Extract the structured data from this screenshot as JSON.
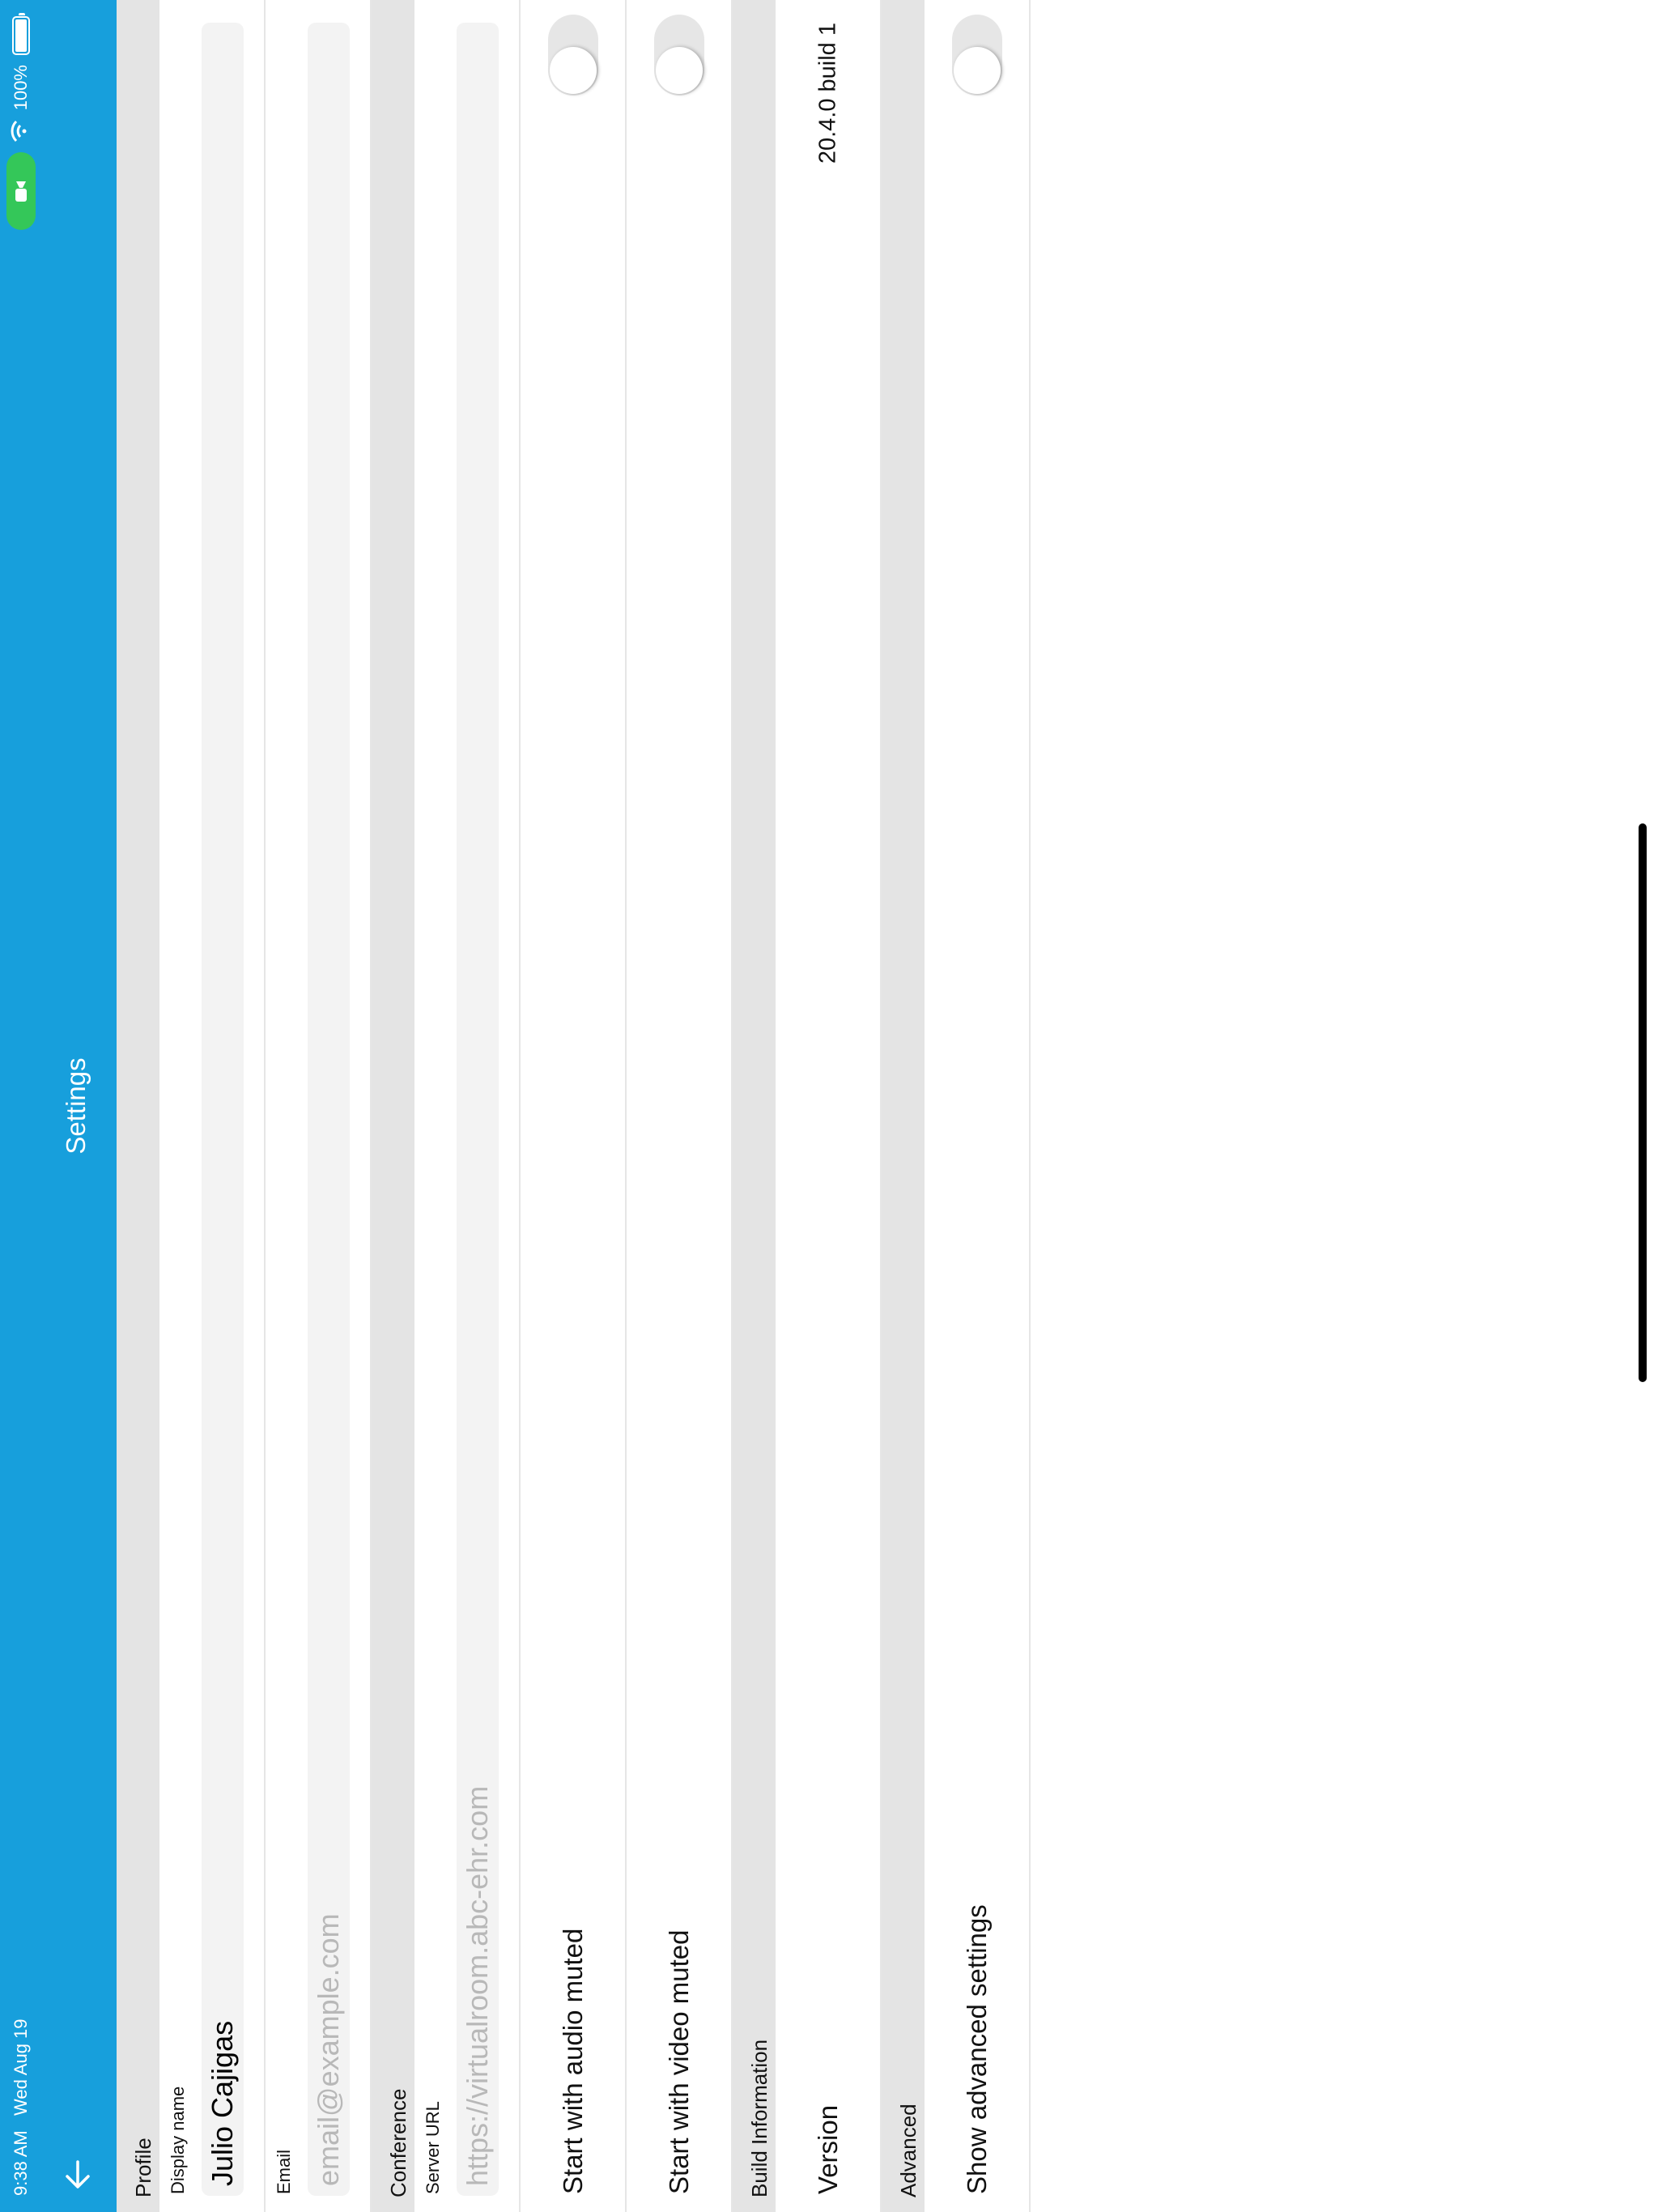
{
  "status_bar": {
    "time": "9:38 AM",
    "date": "Wed Aug 19",
    "battery_percent": "100%",
    "camera_indicator": "video-camera-icon",
    "wifi_icon": "wifi-icon",
    "battery_icon": "battery-icon"
  },
  "navbar": {
    "title": "Settings",
    "back_icon": "arrow-down-icon"
  },
  "profile": {
    "header": "Profile",
    "display_name_label": "Display name",
    "display_name_value": "Julio Cajigas",
    "email_label": "Email",
    "email_value": "",
    "email_placeholder": "email@example.com"
  },
  "conference": {
    "header": "Conference",
    "server_url_label": "Server URL",
    "server_url_value": "",
    "server_url_placeholder": "https://virtualroom.abc-ehr.com",
    "audio_muted_label": "Start with audio muted",
    "audio_muted_on": false,
    "video_muted_label": "Start with video muted",
    "video_muted_on": false
  },
  "build_information": {
    "header": "Build Information",
    "version_label": "Version",
    "version_value": "20.4.0 build 1"
  },
  "advanced": {
    "header": "Advanced",
    "show_advanced_label": "Show advanced settings",
    "show_advanced_on": false
  },
  "colors": {
    "accent": "#179fdc",
    "section_header_bg": "#e4e4e4",
    "toggle_off": "#e6e6e6",
    "camera_pill": "#34c759"
  }
}
